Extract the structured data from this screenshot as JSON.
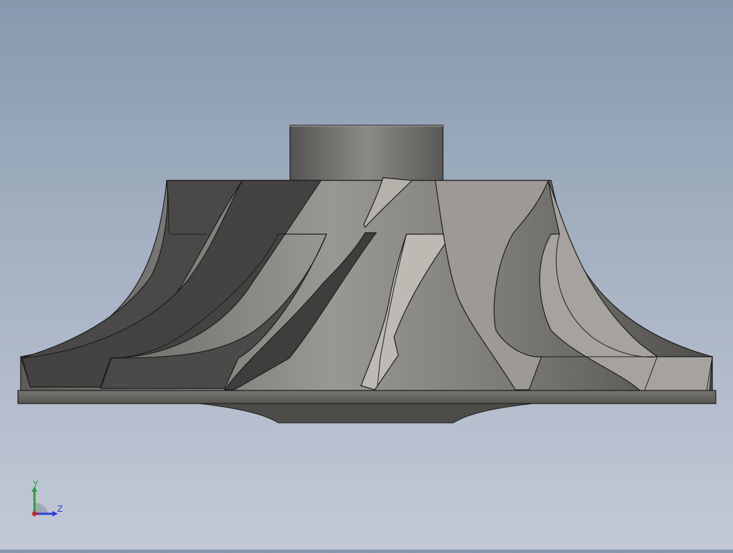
{
  "viewport": {
    "background_top": "#8799ae",
    "background_bottom": "#c3c9d6",
    "model_name": "impeller"
  },
  "triad": {
    "y_label": "Y",
    "z_label": "Z",
    "y_color": "#23a23a",
    "z_color": "#2c3fd0",
    "origin_color": "#d02020"
  }
}
